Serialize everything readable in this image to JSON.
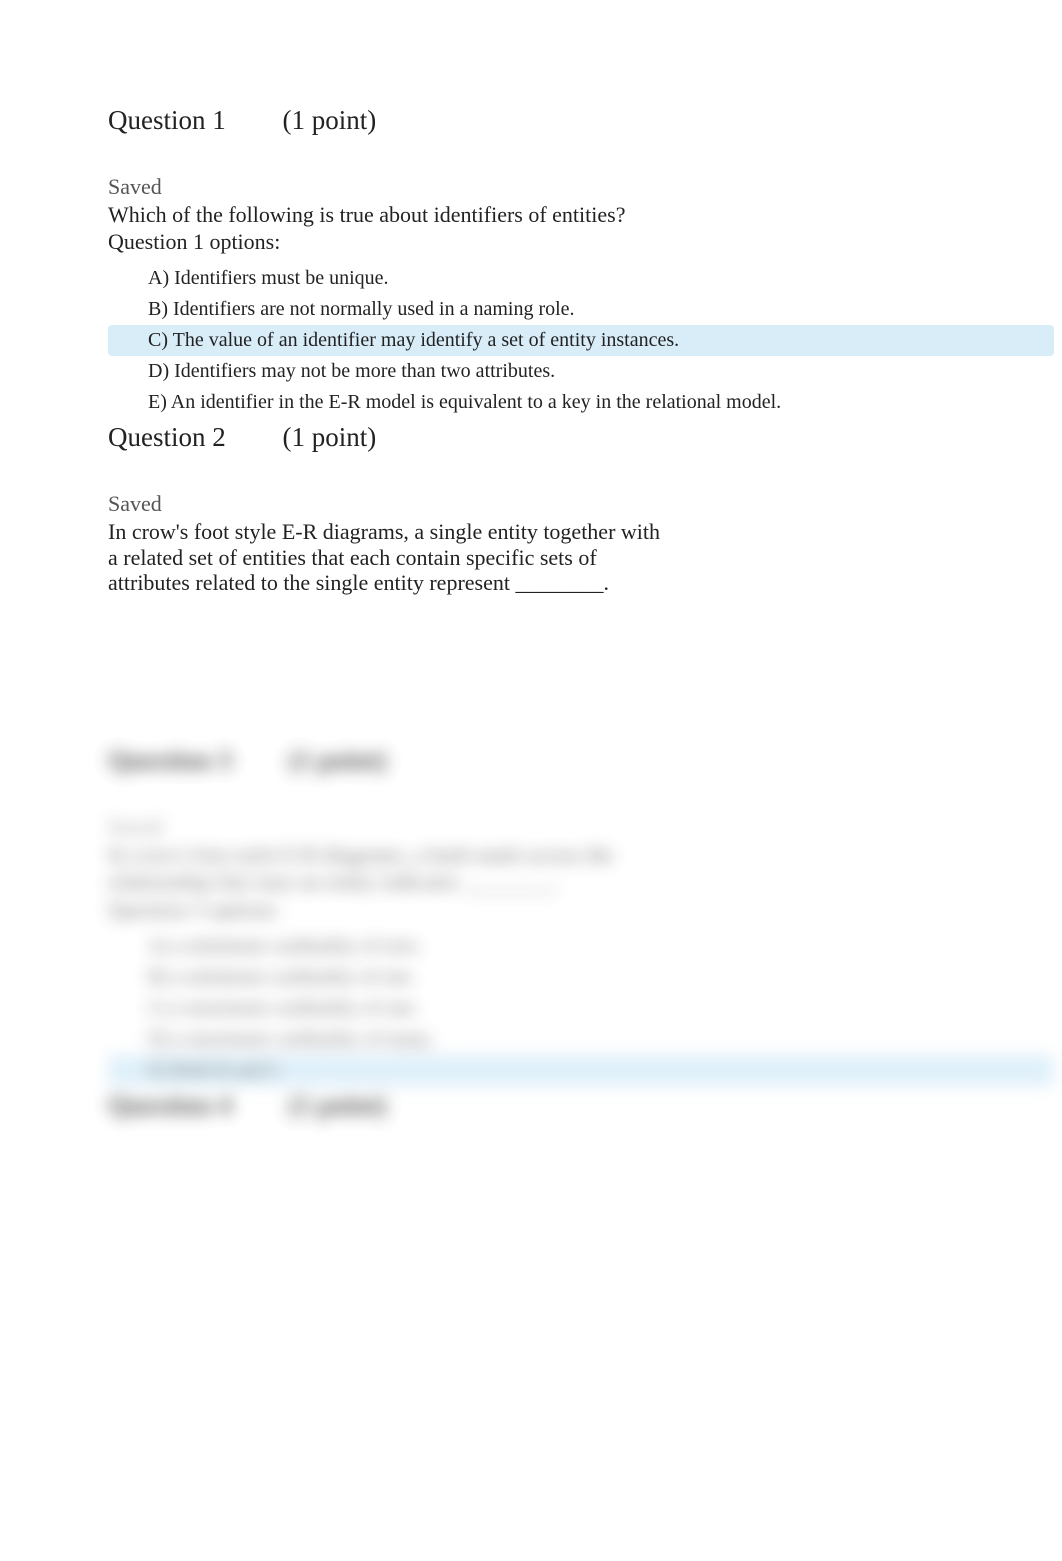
{
  "q1": {
    "header_num": "Question 1",
    "header_pts": "(1 point)",
    "saved": "Saved",
    "text": "Which of the following is true about identifiers of entities?",
    "options_label": "Question 1 options:",
    "optA": "A) Identifiers must be unique.",
    "optB": "B) Identifiers are not normally used in a naming role.",
    "optC": "C) The value of an identifier may identify a set of entity instances.",
    "optD": "D) Identifiers may not be more than two attributes.",
    "optE": "E) An identifier in the E-R model is equivalent to a key in the relational model."
  },
  "q2": {
    "header_num": "Question 2",
    "header_pts": "(1 point)",
    "saved": "Saved",
    "text": "In crow's foot style E-R diagrams, a single entity together with a related set of entities that each contain specific sets of attributes related to the single entity represent ________."
  },
  "q3": {
    "header_num": "Question 3",
    "header_pts": "(1 point)",
    "saved": "Saved",
    "text_line1": "In crow's foot style E-R diagrams, a hash mark across the",
    "text_line2": "relationship line near an entity indicates ________.",
    "options_label": "Question 3 options:",
    "optA": "A) a minimum cardinality of zero.",
    "optB": "B) a minimum cardinality of one.",
    "optC": "C) a maximum cardinality of one.",
    "optD": "D) a maximum cardinality of many.",
    "optE": "E) Both B and C"
  },
  "q4": {
    "header_num": "Question 4",
    "header_pts": "(1 point)"
  }
}
